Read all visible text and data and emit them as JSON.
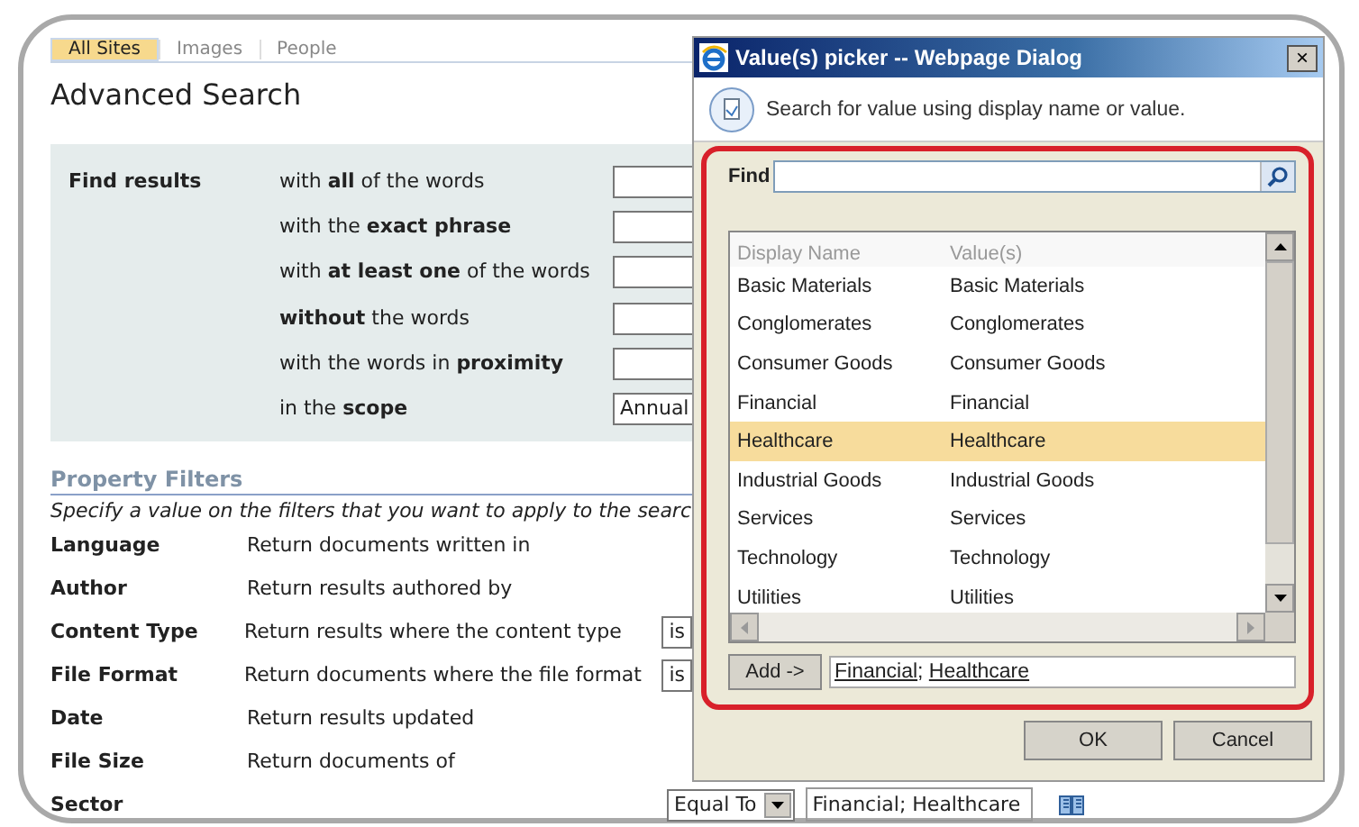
{
  "tabs": [
    {
      "label": "All Sites",
      "selected": true
    },
    {
      "label": "Images",
      "selected": false
    },
    {
      "label": "People",
      "selected": false
    }
  ],
  "title": "Advanced Search",
  "find_results": {
    "label": "Find results",
    "rows": [
      {
        "label": "with **all** of the words",
        "kind": "text"
      },
      {
        "label": "with the **exact phrase**",
        "kind": "text"
      },
      {
        "label": "with **at least one** of the words",
        "kind": "text"
      },
      {
        "label": "**without** the words",
        "kind": "text"
      },
      {
        "label": "with the words in **proximity**",
        "kind": "text"
      },
      {
        "label": "in the **scope**",
        "kind": "select",
        "value": "Annual"
      }
    ]
  },
  "property_filters": {
    "heading": "Property Filters",
    "description": "Specify a value on the filters that you want to apply to the searc",
    "rows": [
      {
        "name": "Language",
        "description": "Return documents written in",
        "kind": "plain"
      },
      {
        "name": "Author",
        "description": "Return results authored by",
        "kind": "plain"
      },
      {
        "name": "Content Type",
        "description": "Return results where the content type",
        "kind": "operator",
        "operator": "is"
      },
      {
        "name": "File Format",
        "description": "Return documents where the file format",
        "kind": "operator",
        "operator": "is"
      },
      {
        "name": "Date",
        "description": "Return results updated",
        "kind": "plain"
      },
      {
        "name": "File Size",
        "description": "Return documents of",
        "kind": "plain"
      },
      {
        "name": "Sector",
        "kind": "picker",
        "operator": "Equal To",
        "value": "Financial; Healthcare"
      }
    ]
  },
  "dialog": {
    "title": "Value(s) picker -- Webpage Dialog",
    "close": "×",
    "subtitle": "Search for value using display name or value.",
    "find_label": "Find",
    "columns": [
      "Display Name",
      "Value(s)"
    ],
    "rows": [
      {
        "display": "Basic Materials",
        "value": "Basic Materials",
        "selected": false
      },
      {
        "display": "Conglomerates",
        "value": "Conglomerates",
        "selected": false
      },
      {
        "display": "Consumer Goods",
        "value": "Consumer Goods",
        "selected": false
      },
      {
        "display": "Financial",
        "value": "Financial",
        "selected": false
      },
      {
        "display": "Healthcare",
        "value": "Healthcare",
        "selected": true
      },
      {
        "display": "Industrial Goods",
        "value": "Industrial Goods",
        "selected": false
      },
      {
        "display": "Services",
        "value": "Services",
        "selected": false
      },
      {
        "display": "Technology",
        "value": "Technology",
        "selected": false
      },
      {
        "display": "Utilities",
        "value": "Utilities",
        "selected": false
      }
    ],
    "add_button": "Add ->",
    "picked": [
      "Financial",
      "Healthcare"
    ],
    "separator": ";",
    "buttons": [
      "OK",
      "Cancel"
    ]
  }
}
